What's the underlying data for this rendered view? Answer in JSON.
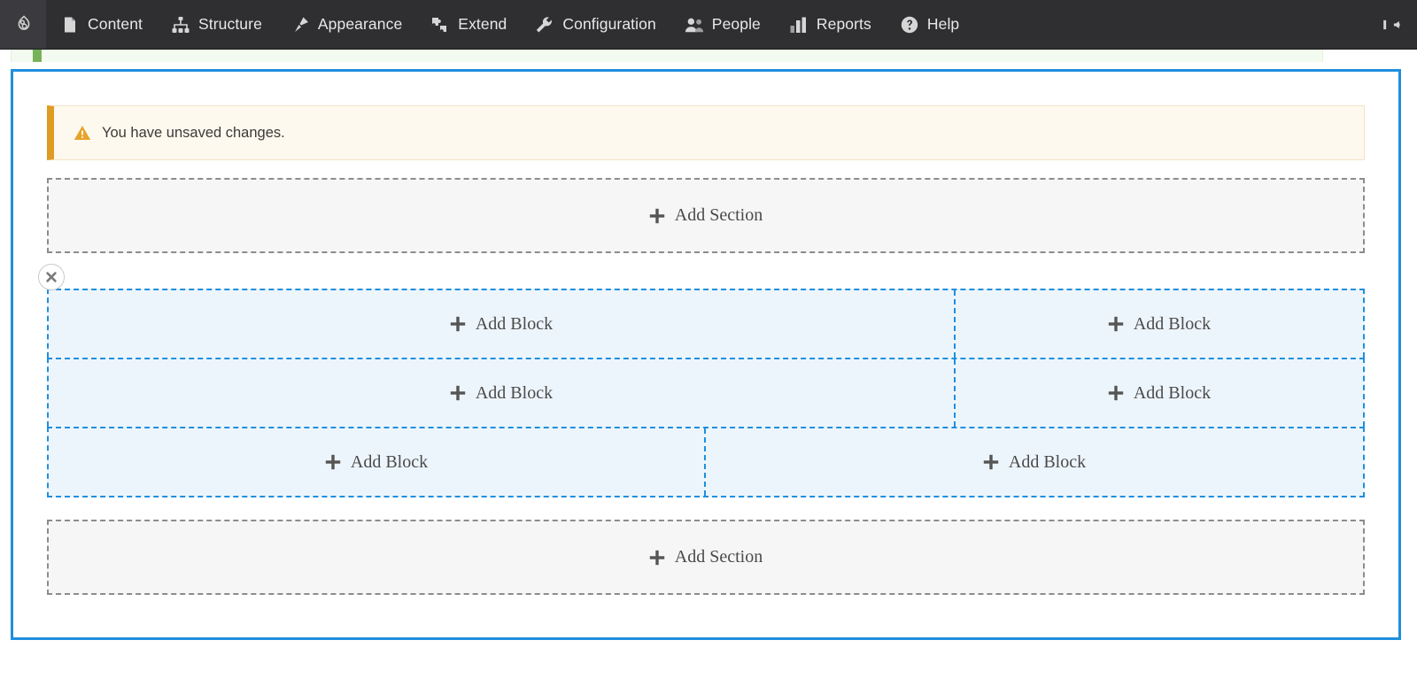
{
  "toolbar": {
    "logo_icon": "drupal-droplet-icon",
    "items": [
      {
        "label": "Content",
        "icon": "document-icon"
      },
      {
        "label": "Structure",
        "icon": "structure-tree-icon"
      },
      {
        "label": "Appearance",
        "icon": "paintbrush-icon"
      },
      {
        "label": "Extend",
        "icon": "puzzle-piece-icon"
      },
      {
        "label": "Configuration",
        "icon": "wrench-icon"
      },
      {
        "label": "People",
        "icon": "people-icon"
      },
      {
        "label": "Reports",
        "icon": "bar-chart-icon"
      },
      {
        "label": "Help",
        "icon": "question-mark-icon"
      }
    ],
    "collapse_icon": "collapse-toolbar-icon",
    "background_color": "#2f2f32",
    "text_color": "#e8e8e8"
  },
  "status_message": {
    "accent_color": "#77b259",
    "background_color": "#f3faef"
  },
  "layout_builder": {
    "border_color": "#1f8fdd",
    "warning": {
      "text": "You have unsaved changes.",
      "icon": "warning-triangle-icon",
      "accent_color": "#e09b22",
      "background_color": "#fdf9ef"
    },
    "add_section_top": {
      "label": "Add Section",
      "icon": "plus-icon"
    },
    "add_section_bottom": {
      "label": "Add Section",
      "icon": "plus-icon"
    },
    "active_section": {
      "remove_icon": "close-x-circle-icon",
      "region_background_color": "#edf5fc",
      "region_border_color": "#1f8fdd",
      "rows": [
        {
          "regions": [
            {
              "label": "Add Block",
              "icon": "plus-icon",
              "width_pct": 69
            },
            {
              "label": "Add Block",
              "icon": "plus-icon",
              "width_pct": 31
            }
          ]
        },
        {
          "regions": [
            {
              "label": "Add Block",
              "icon": "plus-icon",
              "width_pct": 69
            },
            {
              "label": "Add Block",
              "icon": "plus-icon",
              "width_pct": 31
            }
          ]
        },
        {
          "regions": [
            {
              "label": "Add Block",
              "icon": "plus-icon",
              "width_pct": 50
            },
            {
              "label": "Add Block",
              "icon": "plus-icon",
              "width_pct": 50
            }
          ]
        }
      ]
    }
  }
}
